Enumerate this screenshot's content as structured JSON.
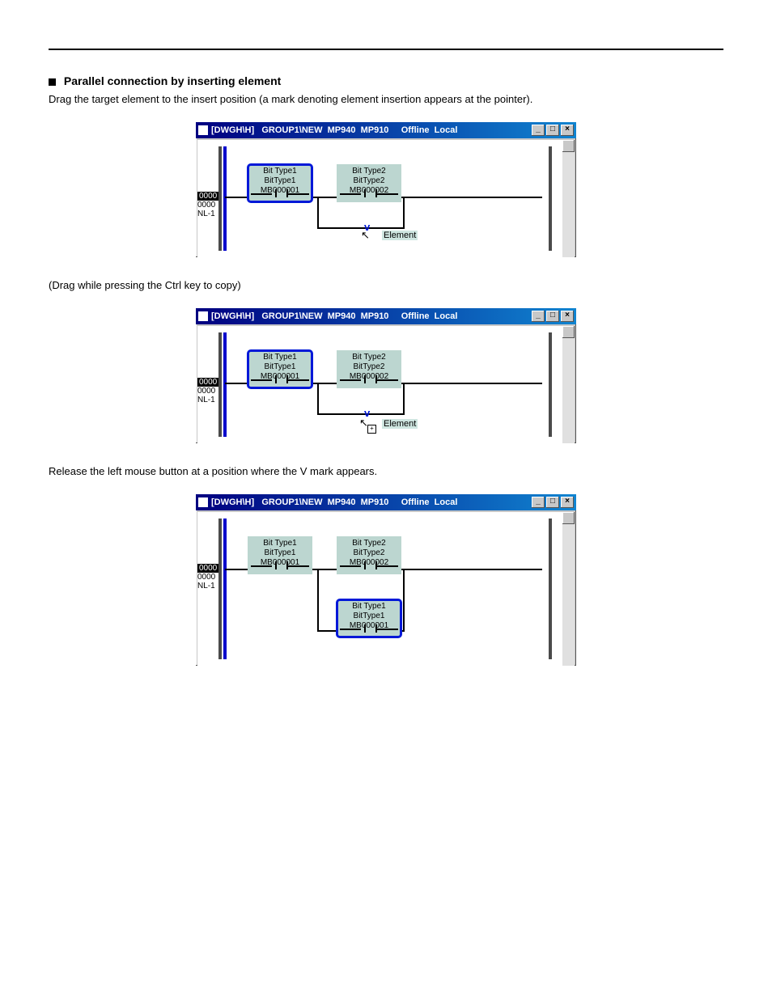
{
  "section": {
    "title": "Parallel connection by inserting element",
    "caption1": "Drag the target element to the insert position (a mark denoting element insertion appears at the pointer).",
    "caption2": "(Drag while pressing the Ctrl key to copy)",
    "caption3": "Release the left mouse button at a position where the V mark appears."
  },
  "win": {
    "title": "[DWGH\\H]   GROUP1\\NEW  MP940  MP910     Offline  Local",
    "btn_min": "_",
    "btn_max": "□",
    "btn_close": "×"
  },
  "step": {
    "addr1": "0000",
    "addr2": "0000",
    "level": "NL-1"
  },
  "elem1": {
    "line1": "Bit Type1",
    "line2": "BitType1",
    "line3": "MB000001"
  },
  "elem2": {
    "line1": "Bit Type2",
    "line2": "BitType2",
    "line3": "MB000002"
  },
  "elem3": {
    "line1": "Bit Type1",
    "line2": "BitType1",
    "line3": "MB000001"
  },
  "tip": {
    "element": "Element"
  }
}
